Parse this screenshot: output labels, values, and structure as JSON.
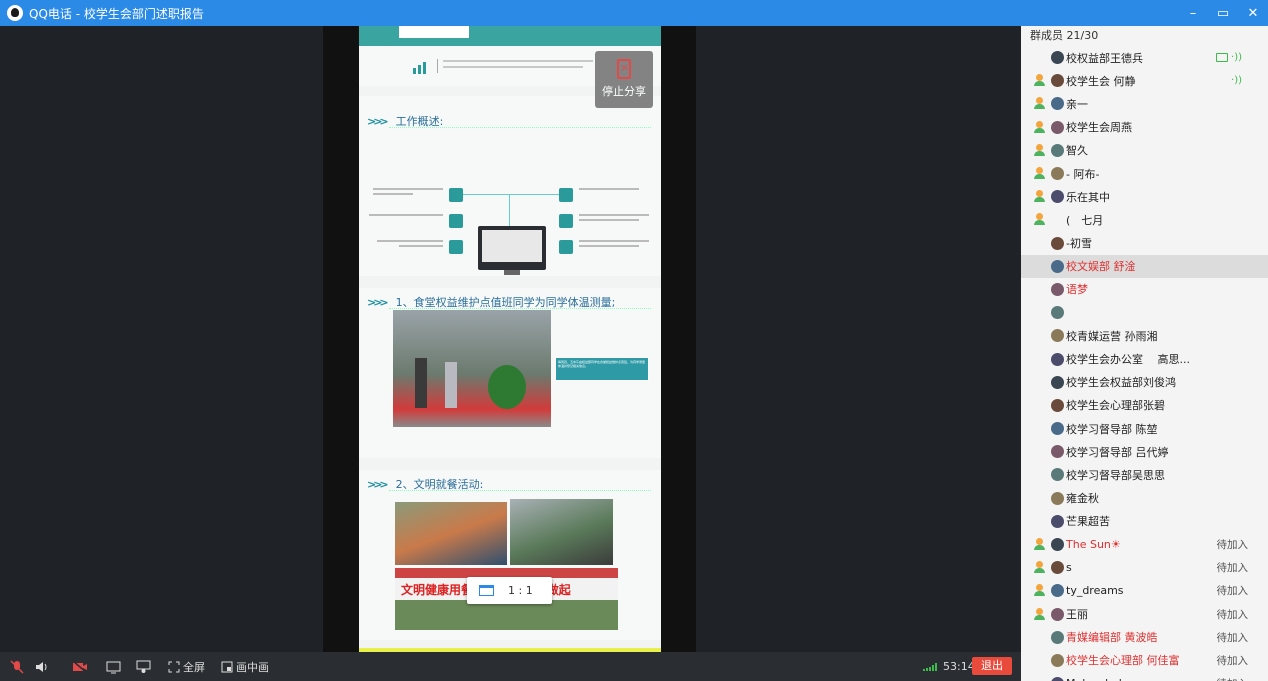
{
  "window": {
    "title": "QQ电话 - 校学生会部门述职报告",
    "minimize": "–",
    "restore": "▭",
    "close": "✕"
  },
  "share": {
    "stop_label": "停止分享",
    "ratio_label": "1 : 1"
  },
  "slides": {
    "overview_title": "工作概述:",
    "section1_title": "1、食堂权益维护点值班同学为同学体温测量;",
    "section1_caption": "每周四、五中午由权益部同学在食堂权益维护点值班，为同学测量体温并登记相关信息。",
    "section2_title": "2、文明就餐活动:",
    "banner_text": "文明健康用餐，“光盘”从我做起"
  },
  "members": {
    "header": "群成员 21/30",
    "list": [
      {
        "name": "校权益部王德兵",
        "manager": false,
        "red": false,
        "status": "",
        "speaking": true,
        "sharing": true
      },
      {
        "name": "校学生会 何静",
        "manager": true,
        "red": false,
        "status": "",
        "speaking": true,
        "sharing": false
      },
      {
        "name": "亲一",
        "manager": true,
        "red": false,
        "status": ""
      },
      {
        "name": "校学生会周燕",
        "manager": true,
        "red": false,
        "status": ""
      },
      {
        "name": "智久",
        "manager": true,
        "red": false,
        "status": ""
      },
      {
        "name": "- 阿布-",
        "manager": true,
        "red": false,
        "status": ""
      },
      {
        "name": "乐在其中",
        "manager": true,
        "red": false,
        "status": ""
      },
      {
        "name": "(　七月",
        "manager": true,
        "red": false,
        "status": "",
        "noavatar": true
      },
      {
        "name": "-初雪",
        "manager": false,
        "red": false,
        "status": ""
      },
      {
        "name": "校文娱部 舒淦",
        "manager": false,
        "red": true,
        "status": "",
        "selected": true
      },
      {
        "name": "语梦",
        "manager": false,
        "red": true,
        "status": ""
      },
      {
        "name": "",
        "manager": false,
        "red": false,
        "status": ""
      },
      {
        "name": "校青媒运营 孙雨湘",
        "manager": false,
        "red": false,
        "status": ""
      },
      {
        "name": "校学生会办公室　 高思...",
        "manager": false,
        "red": false,
        "status": ""
      },
      {
        "name": "校学生会权益部刘俊鸿",
        "manager": false,
        "red": false,
        "status": ""
      },
      {
        "name": "校学生会心理部张碧",
        "manager": false,
        "red": false,
        "status": ""
      },
      {
        "name": "校学习督导部 陈堃",
        "manager": false,
        "red": false,
        "status": ""
      },
      {
        "name": "校学习督导部 吕代婷",
        "manager": false,
        "red": false,
        "status": ""
      },
      {
        "name": "校学习督导部吴思思",
        "manager": false,
        "red": false,
        "status": ""
      },
      {
        "name": "雍金秋",
        "manager": false,
        "red": false,
        "status": ""
      },
      {
        "name": "芒果超苦",
        "manager": false,
        "red": false,
        "status": ""
      },
      {
        "name": "The Sun☀",
        "manager": true,
        "red": true,
        "status": "待加入"
      },
      {
        "name": "s",
        "manager": true,
        "red": false,
        "status": "待加入"
      },
      {
        "name": "ty_dreams",
        "manager": true,
        "red": false,
        "status": "待加入"
      },
      {
        "name": "王丽",
        "manager": true,
        "red": false,
        "status": "待加入"
      },
      {
        "name": "青媒编辑部 黄波皓",
        "manager": false,
        "red": true,
        "status": "待加入"
      },
      {
        "name": "校学生会心理部 何佳富",
        "manager": false,
        "red": true,
        "status": "待加入"
      },
      {
        "name": "Melancholy",
        "manager": false,
        "red": false,
        "status": "待加入"
      }
    ]
  },
  "toolbar": {
    "fullscreen_label": "全屏",
    "pip_label": "画中画",
    "timer": "53:14",
    "hangup_label": "退出"
  },
  "colors": {
    "titlebar": "#2b8ae6",
    "hangup": "#e84a3c",
    "active": "#3cba4c"
  }
}
